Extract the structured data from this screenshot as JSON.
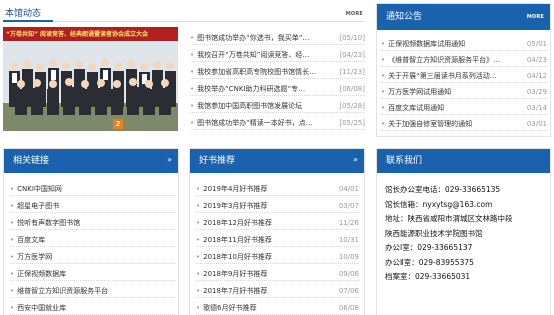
{
  "news": {
    "tab_label": "本馆动态",
    "more": "MORE",
    "banner_text": "“万卷共知” 阅读竞答、经典朗诵暨读者协会成立大会",
    "slide_number": "2",
    "items": [
      {
        "title": "图书馆成功举办“你选书，我买单”…",
        "date": "[05/10]"
      },
      {
        "title": "我校召开“万卷共知”阅读竞答、经…",
        "date": "[04/23]"
      },
      {
        "title": "我校参加省高职高专院校图书馆情长…",
        "date": "[11/23]"
      },
      {
        "title": "我校举办“CNKI助力科研选题”专…",
        "date": "[06/08]"
      },
      {
        "title": "我馆参加中国高职图书馆发展论坛",
        "date": "[05/28]"
      },
      {
        "title": "图书馆成功举办“精读一本好书，点…",
        "date": "[05/25]"
      }
    ]
  },
  "notice": {
    "title": "通知公告",
    "more": "MORE",
    "items": [
      {
        "title": "正保视频数据库试用通知",
        "date": "05/01"
      },
      {
        "title": "《维普智立方知识资源服务平台》…",
        "date": "04/23"
      },
      {
        "title": "关于开展“第三届读书月系列活动…",
        "date": "04/12"
      },
      {
        "title": "万方医学网试用通知",
        "date": "03/29"
      },
      {
        "title": "百度文库试用通知",
        "date": "03/14"
      },
      {
        "title": "关于加强自修室管理的通知",
        "date": "03/01"
      }
    ]
  },
  "links": {
    "title": "相关链接",
    "items": [
      "CNKI中国知网",
      "超星电子图书",
      "悦听有声数字图书馆",
      "百度文库",
      "万方医学网",
      "正保视频数据库",
      "维普智立方知识资源服务平台",
      "西安中国就业库"
    ]
  },
  "books": {
    "title": "好书推荐",
    "items": [
      {
        "title": "2019年4月好书推荐",
        "date": "04/01"
      },
      {
        "title": "2019年3月好书推荐",
        "date": "03/07"
      },
      {
        "title": "2018年12月好书推荐",
        "date": "11/26"
      },
      {
        "title": "2018年11月好书推荐",
        "date": "10/31"
      },
      {
        "title": "2018年10月好书推荐",
        "date": "10/09"
      },
      {
        "title": "2018年9月好书推荐",
        "date": "09/06"
      },
      {
        "title": "2018年7月好书推荐",
        "date": "07/06"
      },
      {
        "title": "歌德6月好书推荐",
        "date": "06/08"
      }
    ]
  },
  "contact": {
    "title": "联系我们",
    "lines": [
      "馆长办公室电话：029-33665135",
      "馆长信箱：nyxytsg@163.com",
      "地址：陕西省咸阳市渭城区文林路中段",
      "陕西能源职业技术学院图书馆",
      "办公Ⅰ室：029-33665137",
      "办公Ⅱ室：029-83955375",
      "档案室：029-33665031"
    ]
  }
}
